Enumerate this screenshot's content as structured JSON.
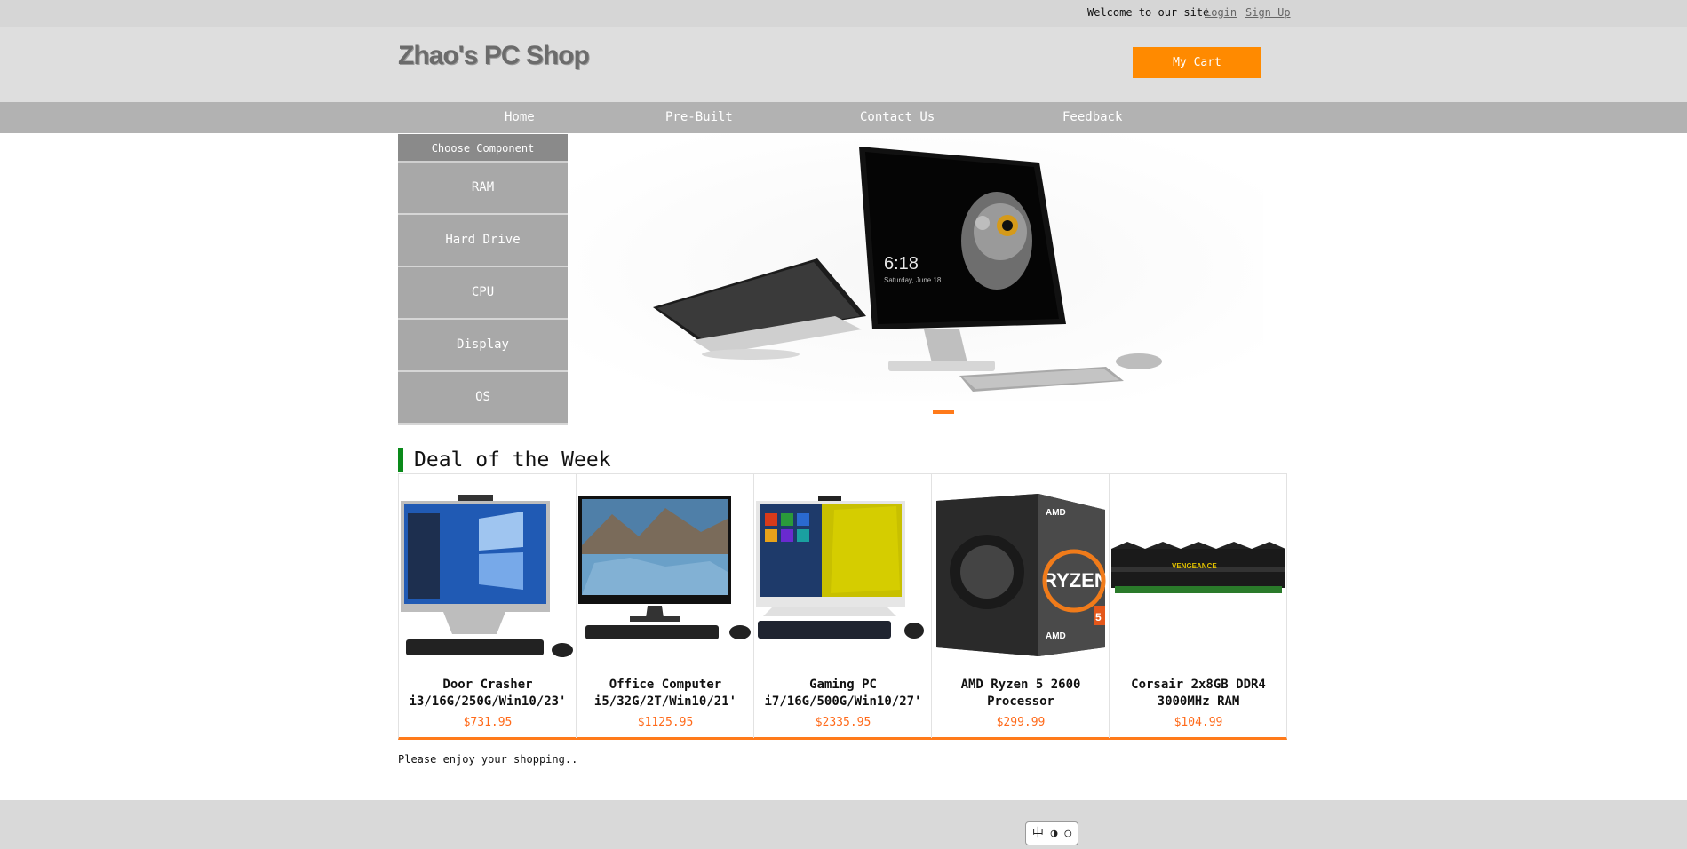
{
  "topbar": {
    "welcome_text": "Welcome to our site",
    "login_label": "Login",
    "signup_label": "Sign Up"
  },
  "header": {
    "logo_text": "Zhao's PC Shop",
    "cart_label": "My Cart"
  },
  "nav": {
    "items": [
      "Home",
      "Pre-Built",
      "Contact Us",
      "Feedback"
    ]
  },
  "sidebar": {
    "heading": "Choose Component",
    "items": [
      "RAM",
      "Hard Drive",
      "CPU",
      "Display",
      "OS"
    ]
  },
  "hero": {
    "clock_time": "6:18",
    "clock_date": "Saturday, June 18"
  },
  "deals": {
    "title": "Deal of the Week",
    "products": [
      {
        "name_line1": "Door Crasher",
        "name_line2": "i3/16G/250G/Win10/23'",
        "price": "$731.95"
      },
      {
        "name_line1": "Office Computer",
        "name_line2": "i5/32G/2T/Win10/21'",
        "price": "$1125.95"
      },
      {
        "name_line1": "Gaming PC",
        "name_line2": "i7/16G/500G/Win10/27'",
        "price": "$2335.95"
      },
      {
        "name_line1": "AMD Ryzen 5 2600",
        "name_line2": "Processor",
        "price": "$299.99"
      },
      {
        "name_line1": "Corsair 2x8GB DDR4",
        "name_line2": "3000MHz RAM",
        "price": "$104.99"
      }
    ],
    "ryzen_box_text": "RYZEN",
    "amd_text": "AMD",
    "ryzen_badge": "5",
    "ram_text": "VENGEANCE"
  },
  "footer": {
    "note": "Please enjoy your shopping..",
    "ime_text": "中 ◑ ○"
  },
  "colors": {
    "accent": "#ff8a00",
    "price": "#ff6a1a",
    "deal_bar": "#0a8a1a",
    "nav_bg": "#b2b2b2"
  }
}
